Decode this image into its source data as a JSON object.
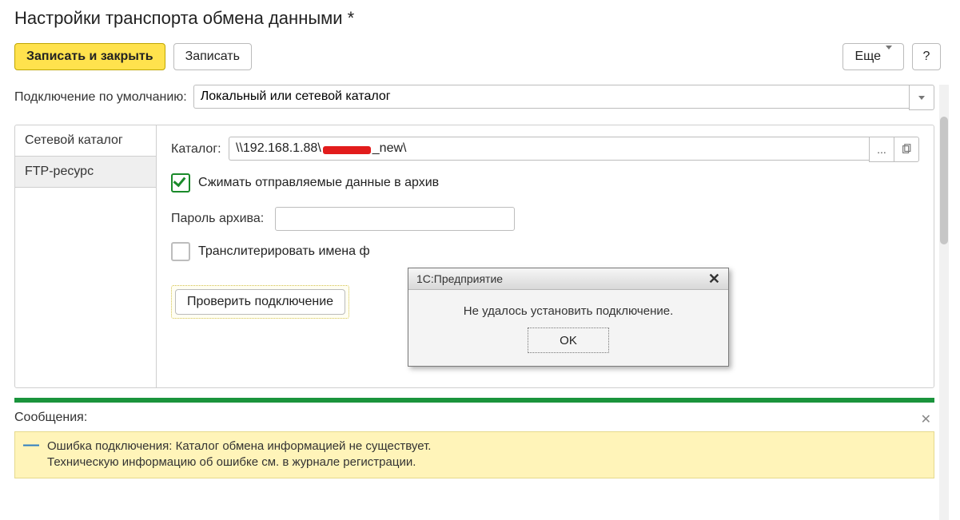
{
  "page": {
    "title": "Настройки транспорта обмена данными *"
  },
  "toolbar": {
    "save_close_label": "Записать и закрыть",
    "save_label": "Записать",
    "more_label": "Еще",
    "help_label": "?"
  },
  "default_conn": {
    "label": "Подключение по умолчанию:",
    "value": "Локальный или сетевой каталог"
  },
  "tabs": {
    "network": "Сетевой каталог",
    "ftp": "FTP-ресурс"
  },
  "catalog": {
    "label": "Каталог:",
    "value_prefix": "\\\\192.168.1.88\\",
    "value_suffix": "_new\\"
  },
  "compress": {
    "label": "Сжимать отправляемые данные в архив",
    "checked": true
  },
  "archive": {
    "label": "Пароль архива:",
    "value": ""
  },
  "translit": {
    "label": "Транслитерировать имена ф",
    "checked": false
  },
  "check_conn_label": "Проверить подключение",
  "messages": {
    "header": "Сообщения:",
    "error_line1": "Ошибка подключения: Каталог обмена информацией не существует.",
    "error_line2": "Техническую информацию об ошибке см. в журнале регистрации."
  },
  "dialog": {
    "title": "1С:Предприятие",
    "text": "Не удалось установить подключение.",
    "ok_label": "OK"
  },
  "icons": {
    "ellipsis": "...",
    "dash": "—"
  }
}
